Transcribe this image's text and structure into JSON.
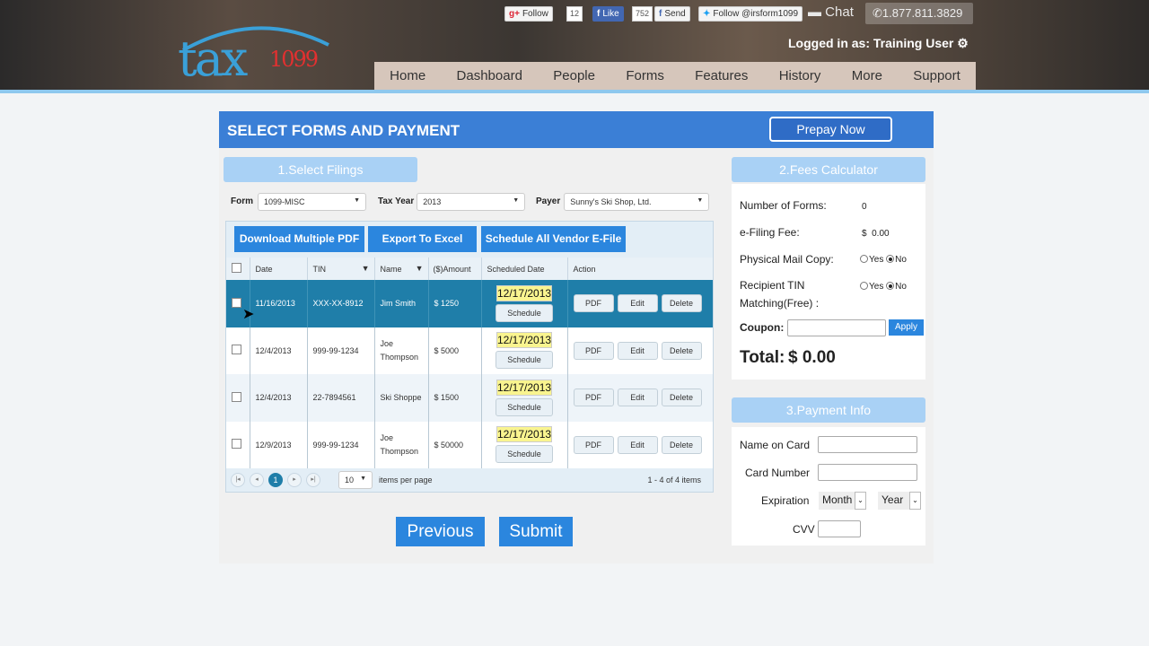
{
  "header": {
    "logo": {
      "main": "tax",
      "number": "1099"
    },
    "social": {
      "gplus_follow": "Follow",
      "gplus_count": "12",
      "fb_like": "Like",
      "fb_like_count": "752",
      "fb_send": "Send",
      "twitter_follow": "Follow @irsform1099"
    },
    "chat": "Chat",
    "phone": "1.877.811.3829",
    "logged_in": "Logged in as: Training User"
  },
  "nav": [
    "Home",
    "Dashboard",
    "People",
    "Forms",
    "Features",
    "History",
    "More",
    "Support"
  ],
  "page": {
    "title": "SELECT FORMS AND PAYMENT",
    "prepay": "Prepay Now"
  },
  "filings": {
    "heading": "1.Select Filings",
    "form_label": "Form",
    "form_value": "1099-MISC",
    "year_label": "Tax Year",
    "year_value": "2013",
    "payer_label": "Payer",
    "payer_value": "Sunny's Ski Shop, Ltd.",
    "buttons": {
      "download": "Download Multiple PDF",
      "export": "Export To Excel",
      "schedule_all": "Schedule All Vendor E-File"
    },
    "columns": [
      "Date",
      "TIN",
      "Name",
      "($)Amount",
      "Scheduled Date",
      "Action"
    ],
    "rows": [
      {
        "date": "11/16/2013",
        "tin": "XXX-XX-8912",
        "name": "Jim Smith",
        "amount": "$ 1250",
        "scheduled": "12/17/2013",
        "selected": true
      },
      {
        "date": "12/4/2013",
        "tin": "999-99-1234",
        "name": "Joe Thompson",
        "amount": "$ 5000",
        "scheduled": "12/17/2013",
        "selected": false
      },
      {
        "date": "12/4/2013",
        "tin": "22-7894561",
        "name": "Ski Shoppe",
        "amount": "$ 1500",
        "scheduled": "12/17/2013",
        "selected": false
      },
      {
        "date": "12/9/2013",
        "tin": "999-99-1234",
        "name": "Joe Thompson",
        "amount": "$ 50000",
        "scheduled": "12/17/2013",
        "selected": false
      }
    ],
    "row_actions": {
      "schedule": "Schedule",
      "pdf": "PDF",
      "edit": "Edit",
      "delete": "Delete"
    },
    "pager": {
      "current": "1",
      "page_size": "10",
      "page_size_label": "items per page",
      "summary": "1 - 4 of 4 items"
    }
  },
  "nav_buttons": {
    "previous": "Previous",
    "submit": "Submit"
  },
  "fees": {
    "heading": "2.Fees Calculator",
    "num_forms_label": "Number of Forms:",
    "num_forms": "0",
    "efile_label": "e-Filing Fee:",
    "efile_value": "$  0.00",
    "mail_label": "Physical Mail Copy:",
    "tin_label_1": "Recipient TIN",
    "tin_label_2": "Matching(Free) :",
    "yes": "Yes",
    "no": "No",
    "coupon_label": "Coupon:",
    "apply": "Apply",
    "total_label": "Total:",
    "total_value": "$ 0.00"
  },
  "payment": {
    "heading": "3.Payment Info",
    "name_label": "Name on Card",
    "number_label": "Card Number",
    "exp_label": "Expiration",
    "month": "Month",
    "year": "Year",
    "cvv_label": "CVV"
  }
}
